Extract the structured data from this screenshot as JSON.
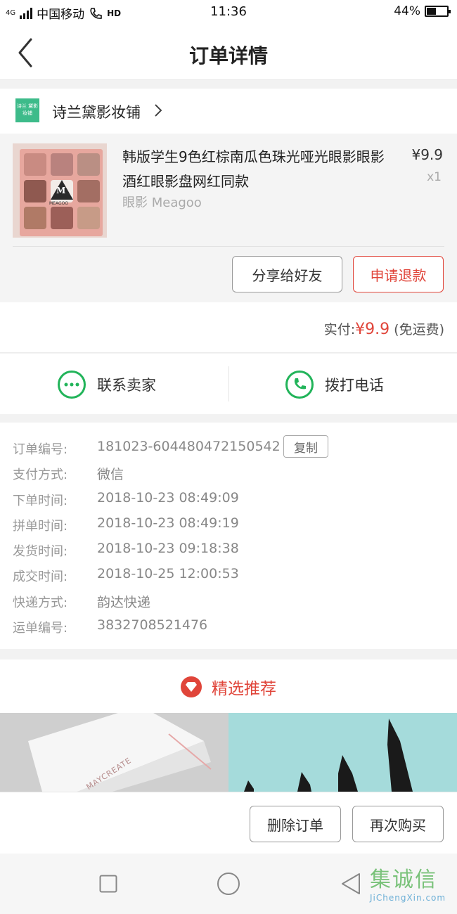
{
  "status_bar": {
    "network": "4G",
    "carrier": "中国移动",
    "hd": "HD",
    "time": "11:36",
    "battery": "44%",
    "battery_level": 0.44
  },
  "header": {
    "title": "订单详情"
  },
  "shop": {
    "logo_text": "诗兰 黛影妆铺",
    "name": "诗兰黛影妆铺"
  },
  "product": {
    "title": "韩版学生9色红棕南瓜色珠光哑光眼影眼影酒红眼影盘网红同款",
    "variant": "眼影 Meagoo",
    "price": "¥9.9",
    "qty": "x1",
    "thumb_logo": "M",
    "thumb_brand": "MEAGOO"
  },
  "actions": {
    "share": "分享给好友",
    "refund": "申请退款"
  },
  "payment": {
    "label": "实付:",
    "amount": "¥9.9",
    "note": "(免运费)"
  },
  "contact": {
    "seller": "联系卖家",
    "call": "拨打电话"
  },
  "order_info": [
    {
      "label": "订单编号:",
      "value": "181023-604480472150542"
    },
    {
      "label": "支付方式:",
      "value": "微信"
    },
    {
      "label": "下单时间:",
      "value": "2018-10-23 08:49:09"
    },
    {
      "label": "拼单时间:",
      "value": "2018-10-23 08:49:19"
    },
    {
      "label": "发货时间:",
      "value": "2018-10-23 09:18:38"
    },
    {
      "label": "成交时间:",
      "value": "2018-10-25 12:00:53"
    },
    {
      "label": "快递方式:",
      "value": "韵达快递"
    },
    {
      "label": "运单编号:",
      "value": "3832708521476"
    }
  ],
  "copy_label": "复制",
  "recommend": {
    "title": "精选推荐",
    "left_brand": "MAYCREATE"
  },
  "bottom_actions": {
    "delete": "删除订单",
    "rebuy": "再次购买"
  },
  "watermark": {
    "main": "集诚信",
    "sub": "JiChengXin.com"
  },
  "colors": {
    "accent_red": "#e0453a",
    "wechat_green": "#22b45a"
  }
}
